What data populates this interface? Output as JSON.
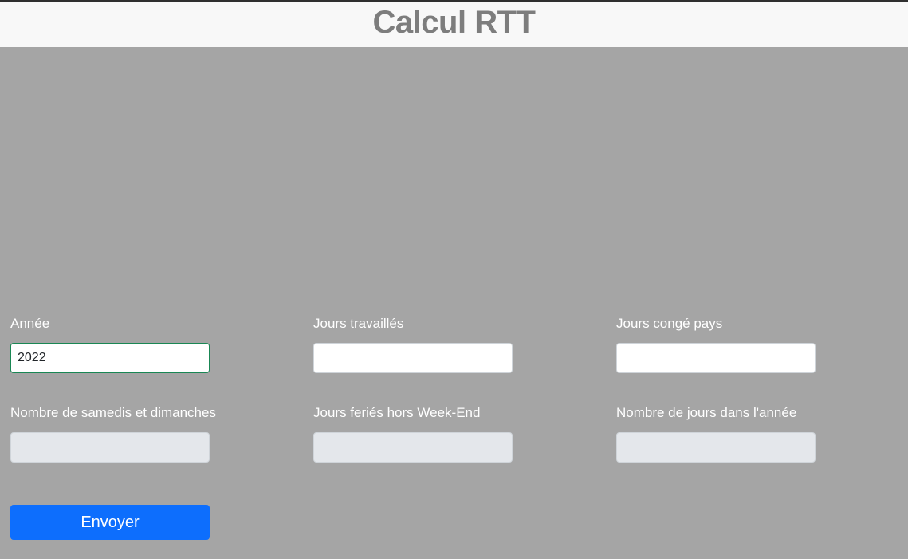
{
  "header": {
    "title": "Calcul RTT"
  },
  "form": {
    "fields": [
      {
        "label": "Année",
        "value": "2022",
        "placeholder": ""
      },
      {
        "label": "Jours travaillés",
        "value": "",
        "placeholder": ""
      },
      {
        "label": "Jours congé pays",
        "value": "",
        "placeholder": ""
      },
      {
        "label": "Nombre de samedis et dimanches",
        "value": "",
        "placeholder": ""
      },
      {
        "label": "Jours feriés hors Week-End",
        "value": "",
        "placeholder": ""
      },
      {
        "label": "Nombre de jours dans l'année",
        "value": "",
        "placeholder": ""
      }
    ],
    "submit_label": "Envoyer"
  },
  "colors": {
    "background": "#a5a5a5",
    "header_background": "#f8f8f8",
    "title": "#7d7d7d",
    "button": "#0d6efd",
    "focus_border": "#198754",
    "disabled_input": "#e4e7eb"
  }
}
